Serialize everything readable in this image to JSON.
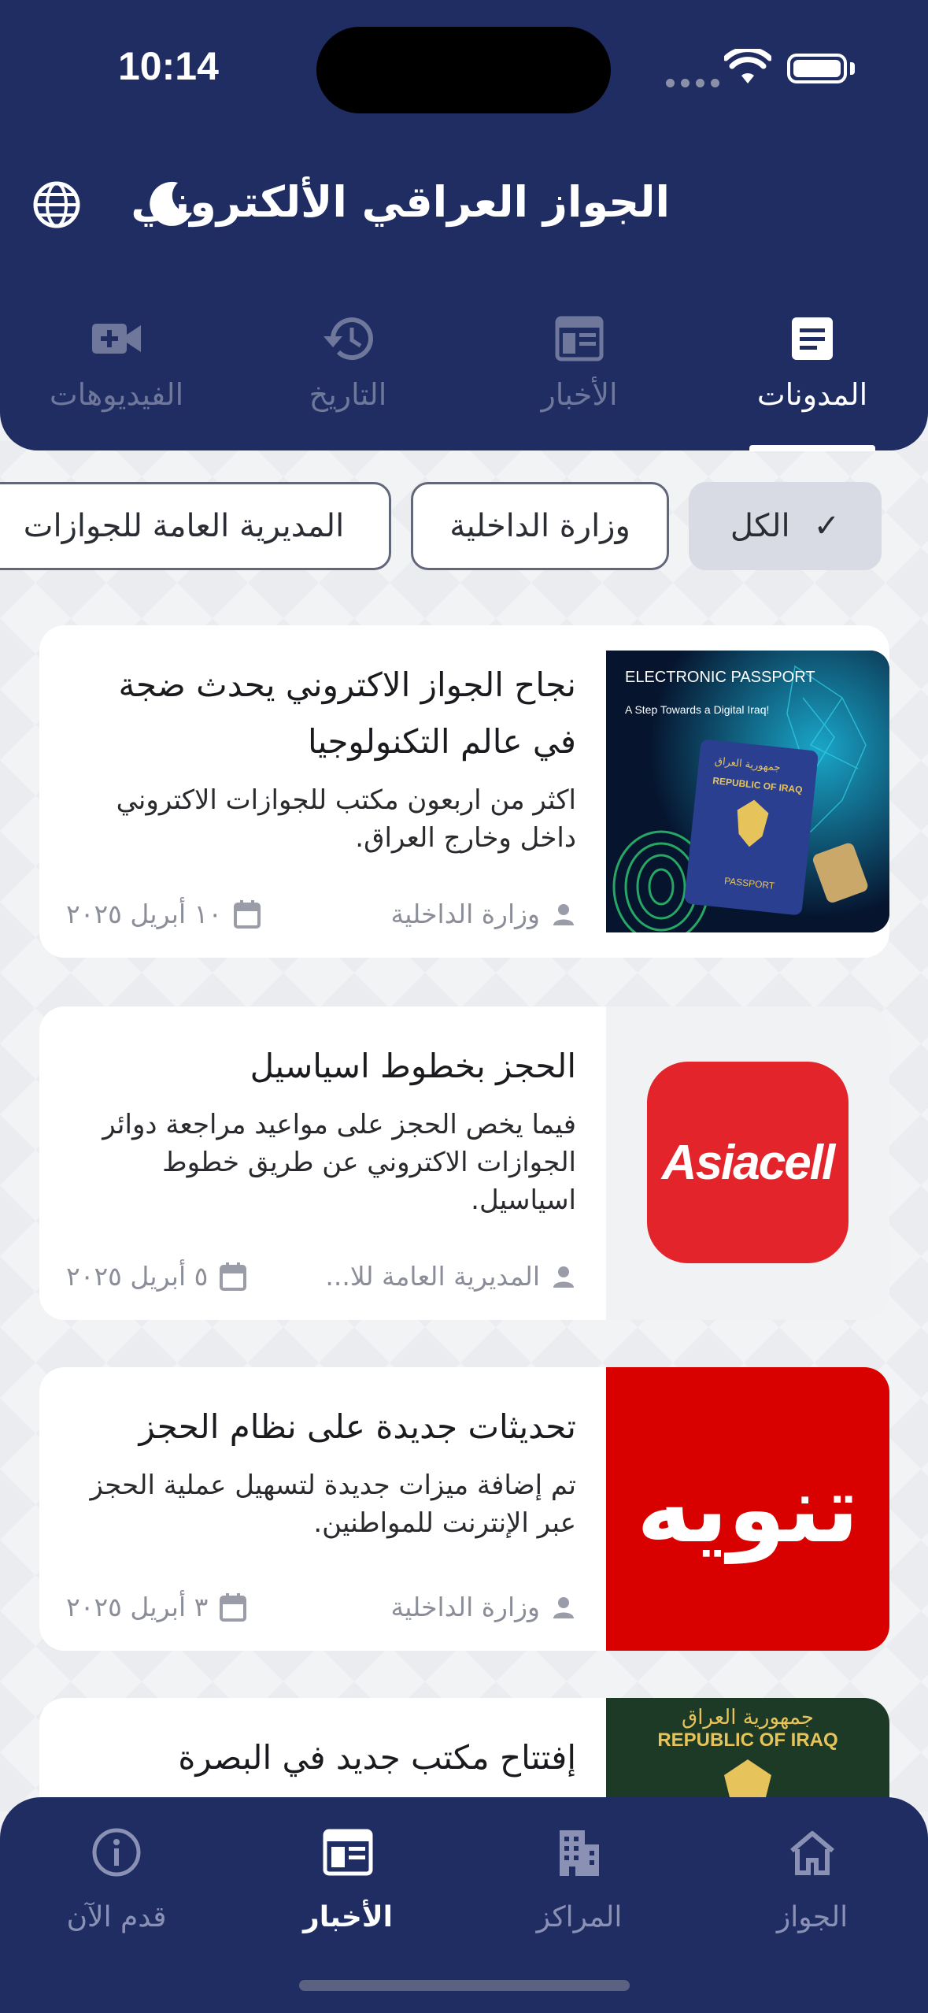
{
  "status_bar": {
    "time": "10:14"
  },
  "header": {
    "title": "الجواز العراقي الألكتروني"
  },
  "tabs": [
    {
      "label": "المدونات",
      "icon": "document-icon",
      "active": true
    },
    {
      "label": "الأخبار",
      "icon": "newspaper-icon",
      "active": false
    },
    {
      "label": "التاريخ",
      "icon": "history-icon",
      "active": false
    },
    {
      "label": "الفيديوهات",
      "icon": "video-add-icon",
      "active": false
    }
  ],
  "filters": [
    {
      "label": "الكل",
      "selected": true
    },
    {
      "label": "وزارة الداخلية",
      "selected": false
    },
    {
      "label": "المديرية العامة للجوازات",
      "selected": false
    }
  ],
  "posts": [
    {
      "title": "نجاح الجواز الاكتروني يحدث ضجة في عالم التكنولوجيا",
      "description": "اكثر من اربعون مكتب للجوازات الاكتروني داخل وخارج العراق.",
      "author": "وزارة الداخلية",
      "date": "١٠ أبريل ٢٠٢٥",
      "thumb": {
        "heading": "ELECTRONIC PASSPORT",
        "sub": "A Step Towards a Digital Iraq!",
        "booklet_text": "REPUBLIC OF IRAQ",
        "booklet_arabic": "جمهورية العراق",
        "booklet_label": "PASSPORT"
      }
    },
    {
      "title": "الحجز بخطوط اسياسيل",
      "description": "فيما يخص الحجز على مواعيد مراجعة دوائر الجوازات الاكتروني عن طريق خطوط اسياسيل.",
      "author": "المديرية العامة للا...",
      "date": "٥ أبريل ٢٠٢٥",
      "thumb": {
        "logo_text": "Asiacell"
      }
    },
    {
      "title": "تحديثات جديدة على نظام الحجز",
      "description": "تم إضافة ميزات جديدة لتسهيل عملية الحجز عبر الإنترنت للمواطنين.",
      "author": "وزارة الداخلية",
      "date": "٣ أبريل ٢٠٢٥",
      "thumb": {
        "banner_text": "تنويه"
      }
    },
    {
      "title": "إفتتاح مكتب جديد في البصرة",
      "thumb": {
        "arabic": "جمهورية العراق",
        "text": "REPUBLIC OF IRAQ"
      }
    }
  ],
  "bottom_nav": [
    {
      "label": "الجواز",
      "icon": "home-icon",
      "active": false
    },
    {
      "label": "المراكز",
      "icon": "buildings-icon",
      "active": false
    },
    {
      "label": "الأخبار",
      "icon": "newspaper-icon",
      "active": true
    },
    {
      "label": "قدم الآن",
      "icon": "info-icon",
      "active": false
    }
  ],
  "colors": {
    "primary": "#1f2d63",
    "background": "#f2f3f5",
    "chip_selected": "#d9dbe4",
    "asiacell_red": "#e3242b",
    "banner_red": "#d90000"
  }
}
